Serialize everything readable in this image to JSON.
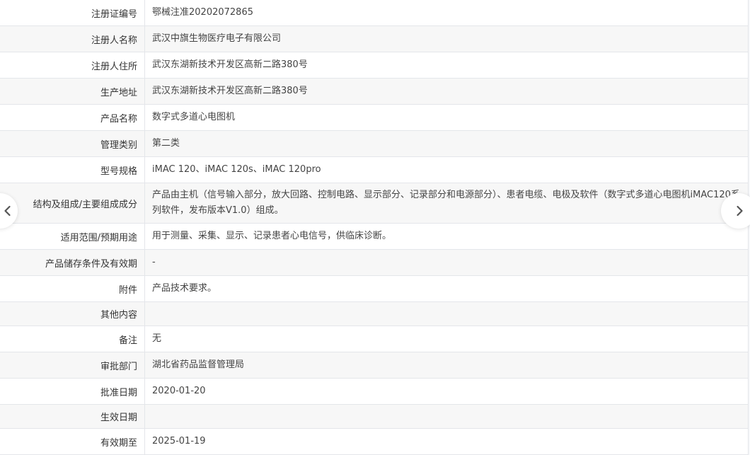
{
  "rows": [
    {
      "label": "注册证编号",
      "value": "鄂械注准20202072865"
    },
    {
      "label": "注册人名称",
      "value": "武汉中旗生物医疗电子有限公司"
    },
    {
      "label": "注册人住所",
      "value": "武汉东湖新技术开发区高新二路380号"
    },
    {
      "label": "生产地址",
      "value": "武汉东湖新技术开发区高新二路380号"
    },
    {
      "label": "产品名称",
      "value": "数字式多道心电图机"
    },
    {
      "label": "管理类别",
      "value": "第二类"
    },
    {
      "label": "型号规格",
      "value": "iMAC 120、iMAC 120s、iMAC 120pro"
    },
    {
      "label": "结构及组成/主要组成成分",
      "value": "产品由主机（信号输入部分，放大回路、控制电路、显示部分、记录部分和电源部分）、患者电缆、电极及软件（数字式多道心电图机iMAC120系列软件，发布版本V1.0）组成。"
    },
    {
      "label": "适用范围/预期用途",
      "value": "用于测量、采集、显示、记录患者心电信号，供临床诊断。"
    },
    {
      "label": "产品储存条件及有效期",
      "value": "-"
    },
    {
      "label": "附件",
      "value": "产品技术要求。"
    },
    {
      "label": "其他内容",
      "value": ""
    },
    {
      "label": "备注",
      "value": "无"
    },
    {
      "label": "审批部门",
      "value": "湖北省药品监督管理局"
    },
    {
      "label": "批准日期",
      "value": "2020-01-20"
    },
    {
      "label": "生效日期",
      "value": ""
    },
    {
      "label": "有效期至",
      "value": "2025-01-19"
    }
  ],
  "nav": {
    "prev_icon": "chevron-left-icon",
    "next_icon": "chevron-right-icon"
  },
  "colors": {
    "border": "#e4e6ea",
    "alt_row": "#f7f7f7",
    "text": "#333333"
  }
}
